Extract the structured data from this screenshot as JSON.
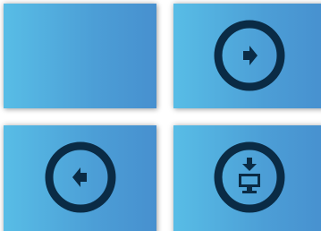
{
  "tiles": [
    {
      "icon": ""
    },
    {
      "icon": "arrow-right-circle-icon"
    },
    {
      "icon": "arrow-left-circle-icon"
    },
    {
      "icon": "download-to-monitor-icon"
    }
  ],
  "colors": {
    "tile_gradient_start": "#58bde6",
    "tile_gradient_end": "#4790cf",
    "icon_color": "#0a2b45"
  }
}
